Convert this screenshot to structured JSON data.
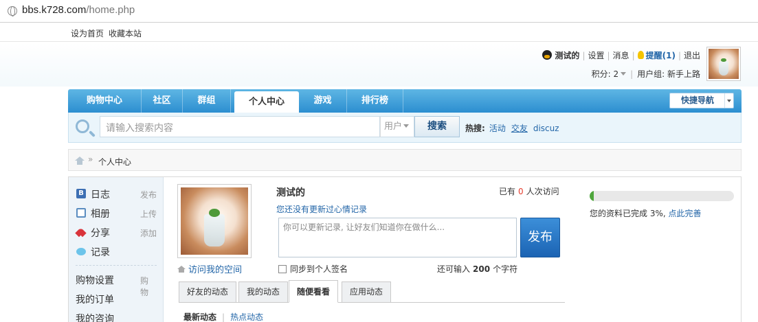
{
  "browser": {
    "url_host": "bbs.k728.com",
    "url_path": "/home.php"
  },
  "toplinks": {
    "set_home": "设为首页",
    "bookmark": "收藏本站"
  },
  "user": {
    "name": "测试的",
    "settings": "设置",
    "messages": "消息",
    "remind": "提醒(1)",
    "logout": "退出",
    "points": "积分: 2",
    "group": "用户组: 新手上路"
  },
  "nav": {
    "items": [
      "购物中心",
      "社区",
      "群组",
      "个人中心",
      "游戏",
      "排行榜"
    ],
    "active_index": 3,
    "quick_nav": "快捷导航"
  },
  "search": {
    "placeholder": "请输入搜索内容",
    "type": "用户",
    "button": "搜索",
    "hot_label": "热搜:",
    "hot_terms": [
      "活动",
      "交友",
      "discuz"
    ]
  },
  "breadcrumb": {
    "current": "个人中心"
  },
  "sidebar": {
    "items": [
      {
        "label": "日志",
        "action": "发布",
        "icon": "blog-icon"
      },
      {
        "label": "相册",
        "action": "上传",
        "icon": "album-icon"
      },
      {
        "label": "分享",
        "action": "添加",
        "icon": "share-icon"
      },
      {
        "label": "记录",
        "action": "",
        "icon": "record-icon"
      }
    ],
    "shop_settings": "购物设置",
    "shop_action": "购物",
    "my_orders": "我的订单",
    "my_consult": "我的咨询"
  },
  "profile": {
    "name": "测试的",
    "visits_prefix": "已有",
    "visits_count": "0",
    "visits_suffix": "人次访问",
    "mood_link": "您还没有更新过心情记录",
    "status_placeholder": "你可以更新记录, 让好友们知道你在做什么...",
    "post_button": "发布",
    "visit_space": "访问我的空间",
    "sync_label": "同步到个人签名",
    "remain_prefix": "还可输入",
    "remain_count": "200",
    "remain_suffix": "个字符"
  },
  "tabs": {
    "items": [
      "好友的动态",
      "我的动态",
      "随便看看",
      "应用动态"
    ],
    "active_index": 2,
    "sub_latest": "最新动态",
    "sub_hot": "热点动态"
  },
  "completion": {
    "percent": 3,
    "text": "您的资料已完成 3%,",
    "link": "点此完善"
  },
  "colors": {
    "nav_blue": "#2c8ed0",
    "link_blue": "#2366a8",
    "progress_green": "#4fa63d",
    "count_red": "#e53b2c"
  }
}
